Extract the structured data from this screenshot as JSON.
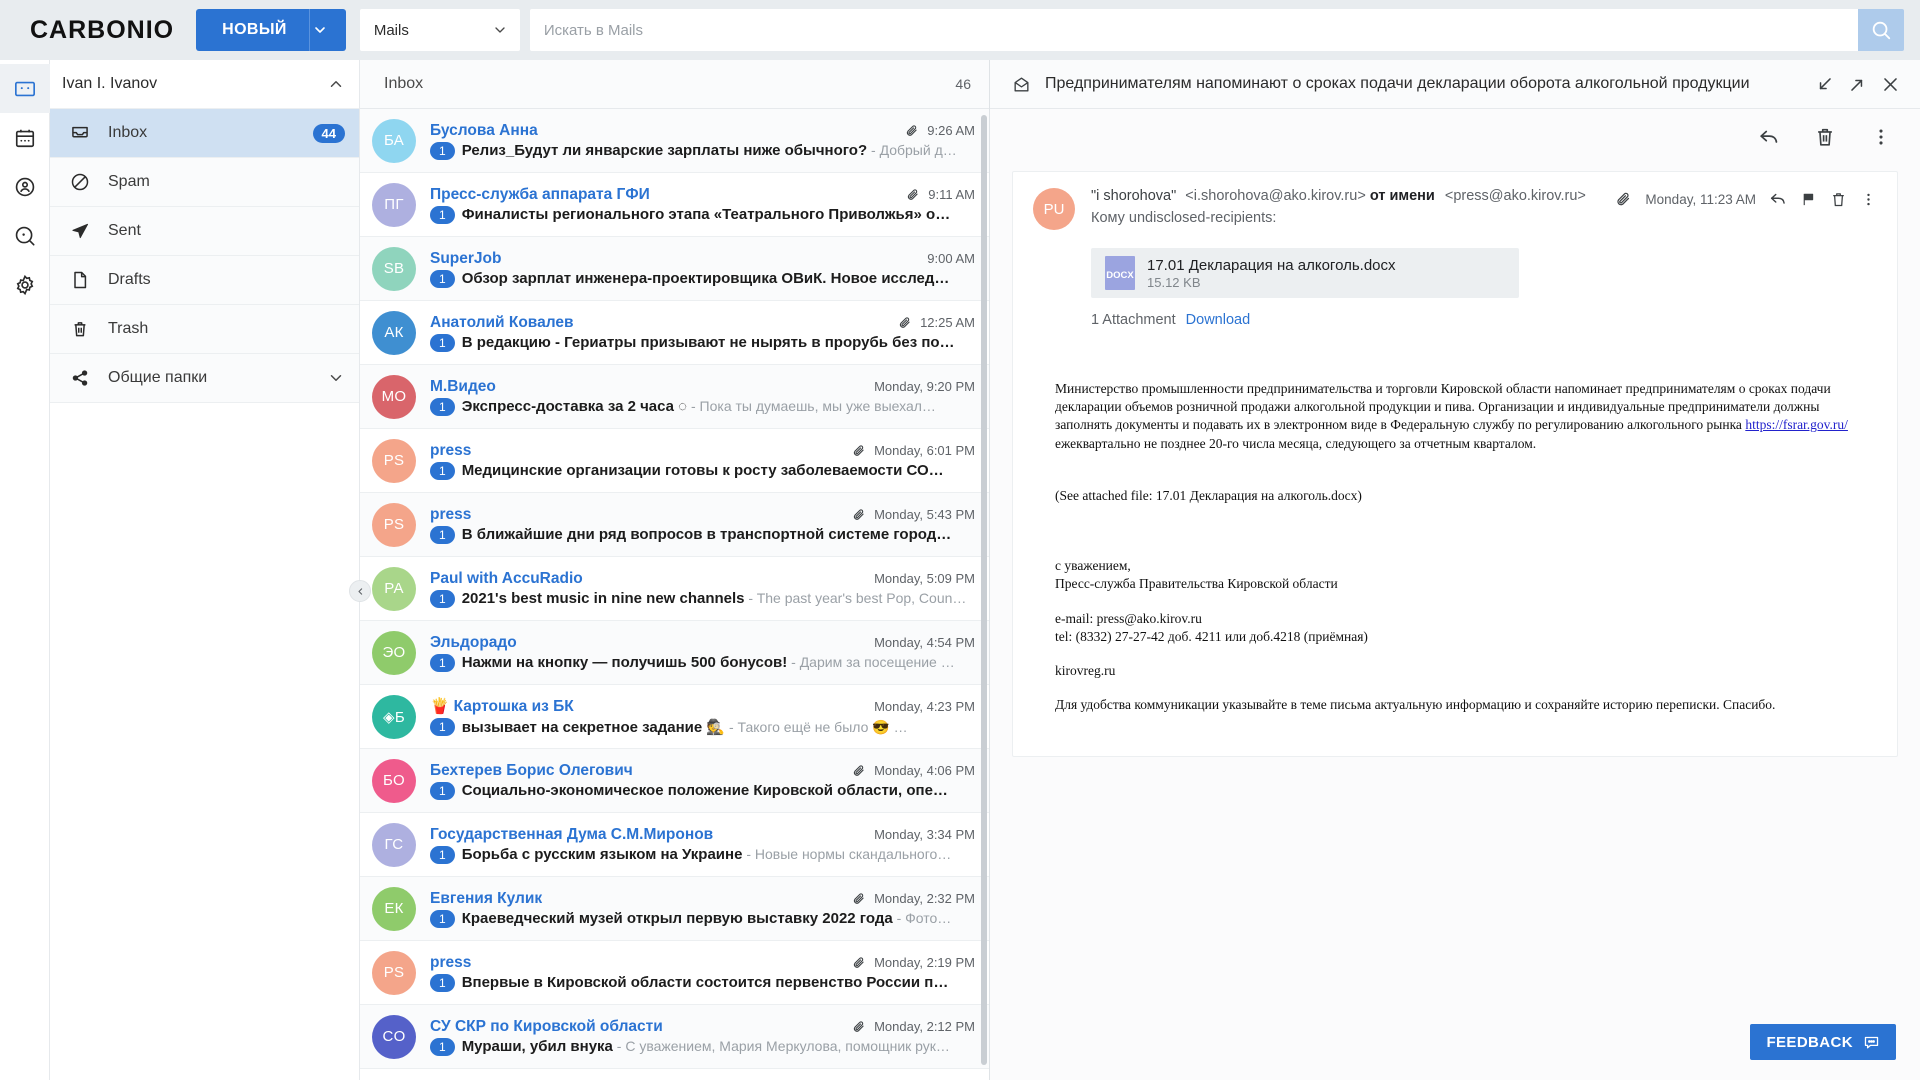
{
  "topbar": {
    "logo": "CARBONIO",
    "new_button": "НОВЫЙ",
    "module_selected": "Mails",
    "search_placeholder": "Искать в Mails",
    "search_value": ""
  },
  "rail": {
    "items": [
      {
        "name": "mail-app",
        "icon": "mail-icon",
        "active": true
      },
      {
        "name": "calendar-app",
        "icon": "calendar-icon",
        "active": false
      },
      {
        "name": "contacts-app",
        "icon": "contacts-icon",
        "active": false
      },
      {
        "name": "search-app",
        "icon": "search-circle-icon",
        "active": false
      },
      {
        "name": "settings-app",
        "icon": "gear-icon",
        "active": false
      }
    ]
  },
  "sidebar": {
    "account": "Ivan I. Ivanov",
    "folders": [
      {
        "label": "Inbox",
        "icon": "inbox-icon",
        "count": "44",
        "active": true
      },
      {
        "label": "Spam",
        "icon": "block-icon",
        "count": "",
        "active": false
      },
      {
        "label": "Sent",
        "icon": "paper-plane-icon",
        "count": "",
        "active": false
      },
      {
        "label": "Drafts",
        "icon": "file-icon",
        "count": "",
        "active": false
      },
      {
        "label": "Trash",
        "icon": "trash-icon",
        "count": "",
        "active": false
      },
      {
        "label": "Общие папки",
        "icon": "share-icon",
        "count": "",
        "active": false,
        "expandable": true
      }
    ]
  },
  "list": {
    "title": "Inbox",
    "count": "46",
    "messages": [
      {
        "initials": "БА",
        "color": "#8fd6f0",
        "sender": "Буслова Анна",
        "count": "1",
        "subject": "Релиз_Будут ли январские зарплаты ниже обычного?",
        "fragment": " - Добрый д…",
        "time": "9:26 AM",
        "attachment": true
      },
      {
        "initials": "ПГ",
        "color": "#aeb0e0",
        "sender": "Пресс-служба аппарата ГФИ",
        "count": "1",
        "subject": "Финалисты регионального этапа «Театрального Приволжья» о…",
        "fragment": "",
        "time": "9:11 AM",
        "attachment": true
      },
      {
        "initials": "SB",
        "color": "#8fd4bd",
        "sender": "SuperJob",
        "count": "1",
        "subject": "Обзор зарплат инженера-проектировщика ОВиК. Новое исслед…",
        "fragment": "",
        "time": "9:00 AM",
        "attachment": false
      },
      {
        "initials": "АК",
        "color": "#3f8fd1",
        "sender": "Анатолий Ковалев",
        "count": "1",
        "subject": "В редакцию - Гериатры призывают не нырять в прорубь без по…",
        "fragment": "",
        "time": "12:25 AM",
        "attachment": true
      },
      {
        "initials": "МО",
        "color": "#d9656b",
        "sender": "М.Видео",
        "count": "1",
        "subject": "Экспресс-доставка за 2 часа ◌",
        "fragment": " - Пока ты думаешь, мы уже выехал…",
        "time": "Monday, 9:20 PM",
        "attachment": false
      },
      {
        "initials": "PS",
        "color": "#f4a58a",
        "sender": "press",
        "count": "1",
        "subject": "Медицинские организации готовы к росту заболеваемости СО…",
        "fragment": "",
        "time": "Monday, 6:01 PM",
        "attachment": true
      },
      {
        "initials": "PS",
        "color": "#f4a58a",
        "sender": "press",
        "count": "1",
        "subject": "В ближайшие дни ряд вопросов в транспортной системе город…",
        "fragment": "",
        "time": "Monday, 5:43 PM",
        "attachment": true
      },
      {
        "initials": "PA",
        "color": "#a9d68a",
        "sender": "Paul with AccuRadio",
        "count": "1",
        "subject": "2021's best music in nine new channels",
        "fragment": " - The past year's best Pop, Coun…",
        "time": "Monday, 5:09 PM",
        "attachment": false
      },
      {
        "initials": "ЭО",
        "color": "#8fcb6b",
        "sender": "Эльдорадо",
        "count": "1",
        "subject": "Нажми на кнопку — получишь 500 бонусов!",
        "fragment": " - Дарим за посещение …",
        "time": "Monday, 4:54 PM",
        "attachment": false
      },
      {
        "initials": "◈Б",
        "color": "#2eb8a0",
        "sender": "🍟 Картошка из БК",
        "count": "1",
        "subject": "вызывает на секретное задание 🕵",
        "fragment": " - Такого ещё не было 😎 …",
        "time": "Monday, 4:23 PM",
        "attachment": false
      },
      {
        "initials": "БО",
        "color": "#ef5b8c",
        "sender": "Бехтерев Борис Олегович",
        "count": "1",
        "subject": "Социально-экономическое положение Кировской области, опе…",
        "fragment": "",
        "time": "Monday, 4:06 PM",
        "attachment": true
      },
      {
        "initials": "ГС",
        "color": "#aeb0e0",
        "sender": "Государственная Дума С.М.Миронов",
        "count": "1",
        "subject": "Борьба с русским языком на Украине",
        "fragment": " - Новые нормы скандального…",
        "time": "Monday, 3:34 PM",
        "attachment": false
      },
      {
        "initials": "ЕК",
        "color": "#8fcb6b",
        "sender": "Евгения Кулик",
        "count": "1",
        "subject": "Краеведческий музей открыл первую выставку 2022 года",
        "fragment": " - Фото…",
        "time": "Monday, 2:32 PM",
        "attachment": true
      },
      {
        "initials": "PS",
        "color": "#f4a58a",
        "sender": "press",
        "count": "1",
        "subject": "Впервые в Кировской области состоится первенство России п…",
        "fragment": "",
        "time": "Monday, 2:19 PM",
        "attachment": true
      },
      {
        "initials": "CO",
        "color": "#5561c9",
        "sender": "СУ СКР по Кировской области",
        "count": "1",
        "subject": "Мураши, убил внука",
        "fragment": " - С уважением, Мария Меркулова, помощник рук…",
        "time": "Monday, 2:12 PM",
        "attachment": true
      }
    ]
  },
  "reader": {
    "subject": "Предпринимателям напоминают о сроках подачи декларации оборота алкогольной продукции",
    "header_icons": [
      "mail-open-icon",
      "collapse-icon",
      "expand-icon",
      "close-icon"
    ],
    "toolbar_icons": [
      "reply-icon",
      "trash-icon",
      "more-vertical-icon"
    ],
    "message": {
      "avatar_initials": "PU",
      "avatar_color": "#f4a58a",
      "from_display": "\"i shorohova\"",
      "from_address": "<i.shorohova@ako.kirov.ru>",
      "on_behalf": "от имени",
      "behalf_address": "<press@ako.kirov.ru>",
      "to_line": "Кому undisclosed-recipients:",
      "date": "Monday, 11:23 AM",
      "action_icons": [
        "attachment-icon",
        "reply-icon",
        "flag-icon",
        "trash-icon",
        "more-vertical-icon"
      ],
      "attachment": {
        "type_label": "DOCX",
        "filename": "17.01 Декларация на алкоголь.docx",
        "size": "15.12 KB",
        "footer_count": "1 Attachment",
        "download_label": "Download"
      },
      "body_paragraph_1": "Министерство промышленности предпринимательства и торговли Кировской области напоминает предпринимателям о сроках подачи декларации объемов розничной продажи алкогольной продукции и пива. Организации и индивидуальные предприниматели должны заполнять документы и подавать их в электронном виде в Федеральную службу по регулированию алкогольного рынка ",
      "body_link": "https://fsrar.gov.ru/",
      "body_paragraph_1b": " ежеквартально не позднее 20-го числа месяца, следующего за отчетным кварталом.",
      "body_attached_note": "(See attached file: 17.01 Декларация на алкоголь.docx)",
      "sig_regards": "с уважением,",
      "sig_org": "Пресс-служба Правительства Кировской области",
      "sig_email": "e-mail: press@ako.kirov.ru",
      "sig_tel": "tel: (8332) 27-27-42 доб. 4211 или доб.4218 (приёмная)",
      "sig_site": "kirovreg.ru",
      "sig_note": "Для удобства коммуникации указывайте в теме письма актуальную информацию и сохраняйте историю переписки. Спасибо."
    }
  },
  "feedback": {
    "label": "FEEDBACK"
  },
  "colors": {
    "accent": "#2b73d2",
    "topbar_bg": "#e8ecef",
    "selected_folder": "#cfe0f2"
  }
}
